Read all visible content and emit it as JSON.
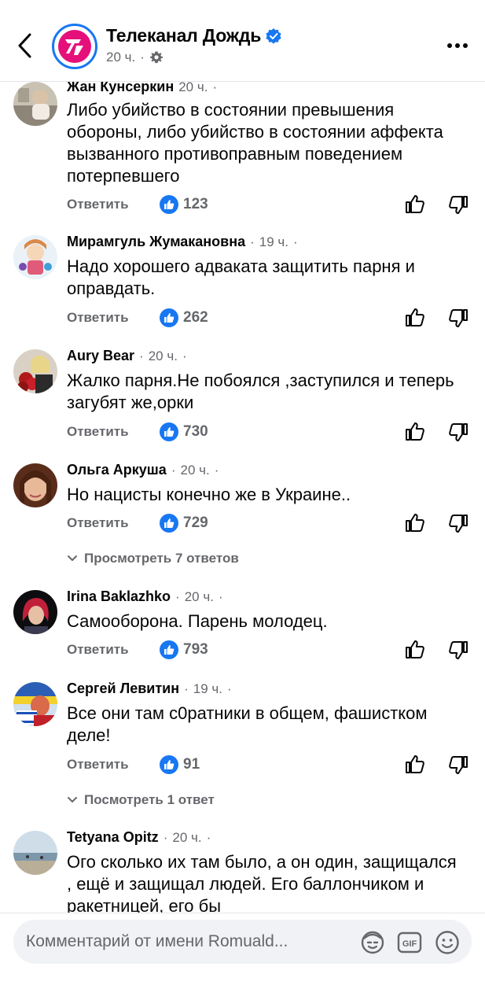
{
  "header": {
    "channel_name": "Телеканал Дождь",
    "time": "20 ч.",
    "separator": "·"
  },
  "comments": [
    {
      "author": "Жан Кунсеркин",
      "time": "20 ч.",
      "text": "Либо убийство в состоянии превышения обороны, либо убийство в состоянии аффекта вызванного противоправным поведением потерпевшего",
      "reply": "Ответить",
      "likes": "123"
    },
    {
      "author": "Мирамгуль Жумакановна",
      "time": "19 ч.",
      "text": "Надо хорошего адваката защитить парня и оправдать.",
      "reply": "Ответить",
      "likes": "262"
    },
    {
      "author": "Aury Bear",
      "time": "20 ч.",
      "text": "Жалко парня.Не побоялся ,заступился и теперь загубят же,орки",
      "reply": "Ответить",
      "likes": "730"
    },
    {
      "author": "Ольга Аркуша",
      "time": "20 ч.",
      "text": "Но нацисты конечно же в Украине..",
      "reply": "Ответить",
      "likes": "729",
      "view_replies": "Просмотреть 7 ответов"
    },
    {
      "author": "Irina Baklazhko",
      "time": "20 ч.",
      "text": "Самооборона. Парень молодец.",
      "reply": "Ответить",
      "likes": "793"
    },
    {
      "author": "Сергей Левитин",
      "time": "19 ч.",
      "text": "Все они там с0ратники в общем, фашистком деле!",
      "reply": "Ответить",
      "likes": "91",
      "view_replies": "Посмотреть 1 ответ"
    },
    {
      "author": "Tetyana Opitz",
      "time": "20 ч.",
      "text": "Ого сколько их там было, а он один, защищался , ещё и защищал людей. Его баллончиком и ракетницей, его бы"
    }
  ],
  "composer": {
    "placeholder": "Комментарий от имени Romuald..."
  },
  "colors": {
    "accent": "#1877f2",
    "secondary_text": "#65676b",
    "brand": "#e5107a"
  }
}
